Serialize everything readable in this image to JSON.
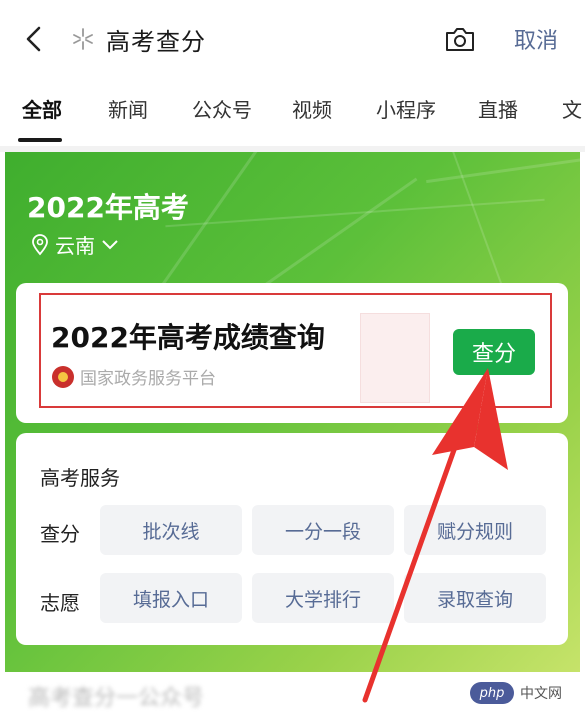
{
  "search": {
    "query": "高考查分",
    "cancel_label": "取消"
  },
  "tabs": [
    {
      "label": "全部",
      "active": true
    },
    {
      "label": "新闻"
    },
    {
      "label": "公众号"
    },
    {
      "label": "视频"
    },
    {
      "label": "小程序"
    },
    {
      "label": "直播"
    },
    {
      "label": "文"
    }
  ],
  "banner": {
    "title": "2022年高考",
    "location": "云南"
  },
  "result_card": {
    "title": "2022年高考成绩查询",
    "source": "国家政务服务平台",
    "button_label": "查分"
  },
  "services": {
    "title": "高考服务",
    "rows": [
      {
        "label": "查分",
        "items": [
          "批次线",
          "一分一段",
          "赋分规则"
        ]
      },
      {
        "label": "志愿",
        "items": [
          "填报入口",
          "大学排行",
          "录取查询"
        ]
      }
    ]
  },
  "bottom": {
    "text": "高考查分一公众号",
    "watermark": "php",
    "watermark_suffix": "中文网"
  },
  "colors": {
    "brand_green": "#1aab4a",
    "link_blue": "#576b95",
    "highlight_red": "#d93a3a"
  }
}
